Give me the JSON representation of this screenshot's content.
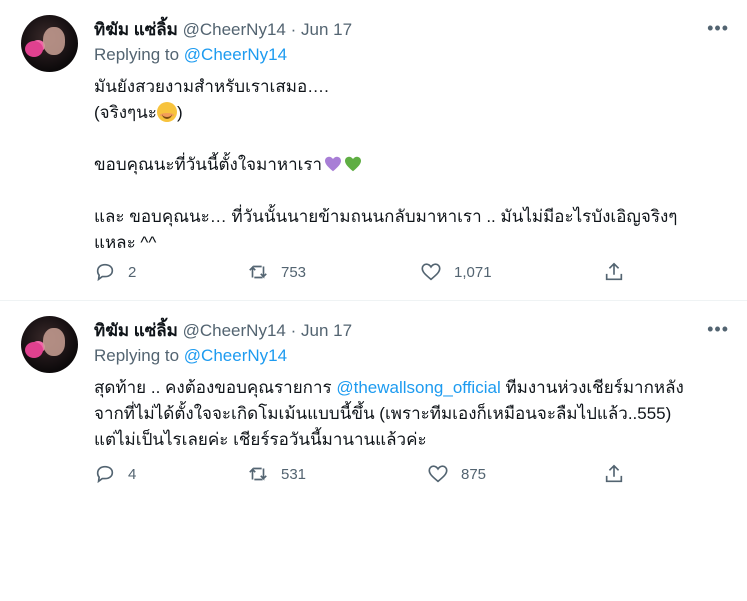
{
  "tweets": [
    {
      "name": "ทิฆัม แซ่ลิ้ม",
      "handle": "@CheerNy14",
      "separator": "·",
      "date": "Jun 17",
      "replying_prefix": "Replying to",
      "replying_handle": "@CheerNy14",
      "lines": {
        "l1": "มันยังสวยงามสำหรับเราเสมอ….",
        "l2": "(จริงๆนะ",
        "l2_end": ")",
        "l3": "ขอบคุณนะที่วันนี้ตั้งใจมาหาเรา",
        "l4": "และ ขอบคุณนะ… ที่วันนั้นนายข้ามถนนกลับมาหาเรา .. มันไม่มีอะไรบังเอิญจริงๆ",
        "l5": "แหละ ^^"
      },
      "replies": "2",
      "retweets": "753",
      "likes": "1,071"
    },
    {
      "name": "ทิฆัม แซ่ลิ้ม",
      "handle": "@CheerNy14",
      "separator": "·",
      "date": "Jun 17",
      "replying_prefix": "Replying to",
      "replying_handle": "@CheerNy14",
      "lines": {
        "l1a": "สุดท้าย .. คงต้องขอบคุณรายการ ",
        "l1_mention": "@thewallsong_official",
        "l1b": " ทีมงานห่วงเชียร์มากหลัง",
        "l2": "จากที่ไม่ได้ตั้งใจจะเกิดโมเม้นแบบนี้ขึ้น (เพราะทีมเองก็เหมือนจะลืมไปแล้ว..555)",
        "l3": "แต่ไม่เป็นไรเลยค่ะ เชียร์รอวันนี้มานานแล้วค่ะ"
      },
      "replies": "4",
      "retweets": "531",
      "likes": "875"
    }
  ],
  "icons": {
    "more": "more-horizontal-icon",
    "reply": "speech-bubble-icon",
    "retweet": "retweet-arrows-icon",
    "like": "heart-outline-icon",
    "share": "share-upload-icon"
  },
  "colors": {
    "link": "#1d9bf0",
    "secondary": "#536471",
    "text": "#0f1419",
    "purple_heart": "#a87ed6",
    "green_heart": "#5fae43"
  }
}
